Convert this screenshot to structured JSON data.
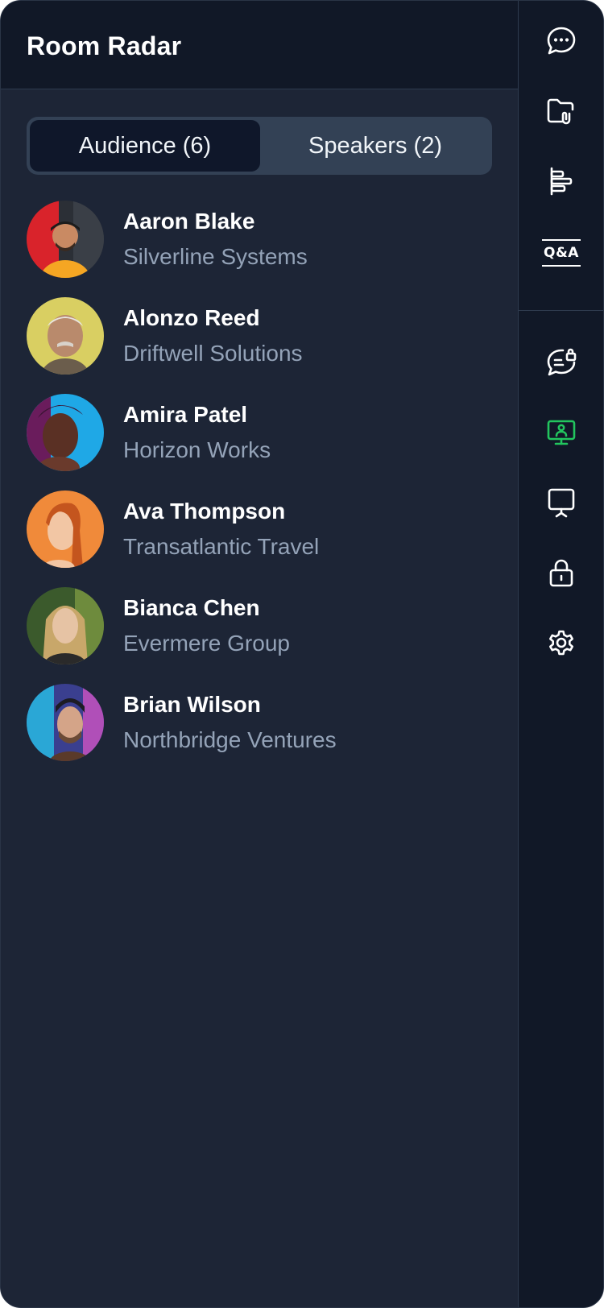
{
  "header": {
    "title": "Room Radar"
  },
  "tabs": {
    "audience_label": "Audience (6)",
    "speakers_label": "Speakers (2)",
    "active": "audience"
  },
  "attendees": [
    {
      "name": "Aaron Blake",
      "company": "Silverline Systems"
    },
    {
      "name": "Alonzo Reed",
      "company": "Driftwell Solutions"
    },
    {
      "name": "Amira Patel",
      "company": "Horizon Works"
    },
    {
      "name": "Ava Thompson",
      "company": "Transatlantic Travel"
    },
    {
      "name": "Bianca Chen",
      "company": "Evermere Group"
    },
    {
      "name": "Brian Wilson",
      "company": "Northbridge Ventures"
    }
  ],
  "rail": {
    "icons": [
      "chat-icon",
      "folder-attachment-icon",
      "agenda-icon",
      "qa-icon",
      "private-chat-icon",
      "presenter-screen-icon",
      "whiteboard-icon",
      "lock-icon",
      "settings-icon"
    ],
    "qa_label": "Q&A",
    "active_icon": "presenter-screen-icon"
  },
  "colors": {
    "background": "#1d2536",
    "header": "#111827",
    "accent": "#22c55e",
    "muted_text": "#94a3b8"
  }
}
